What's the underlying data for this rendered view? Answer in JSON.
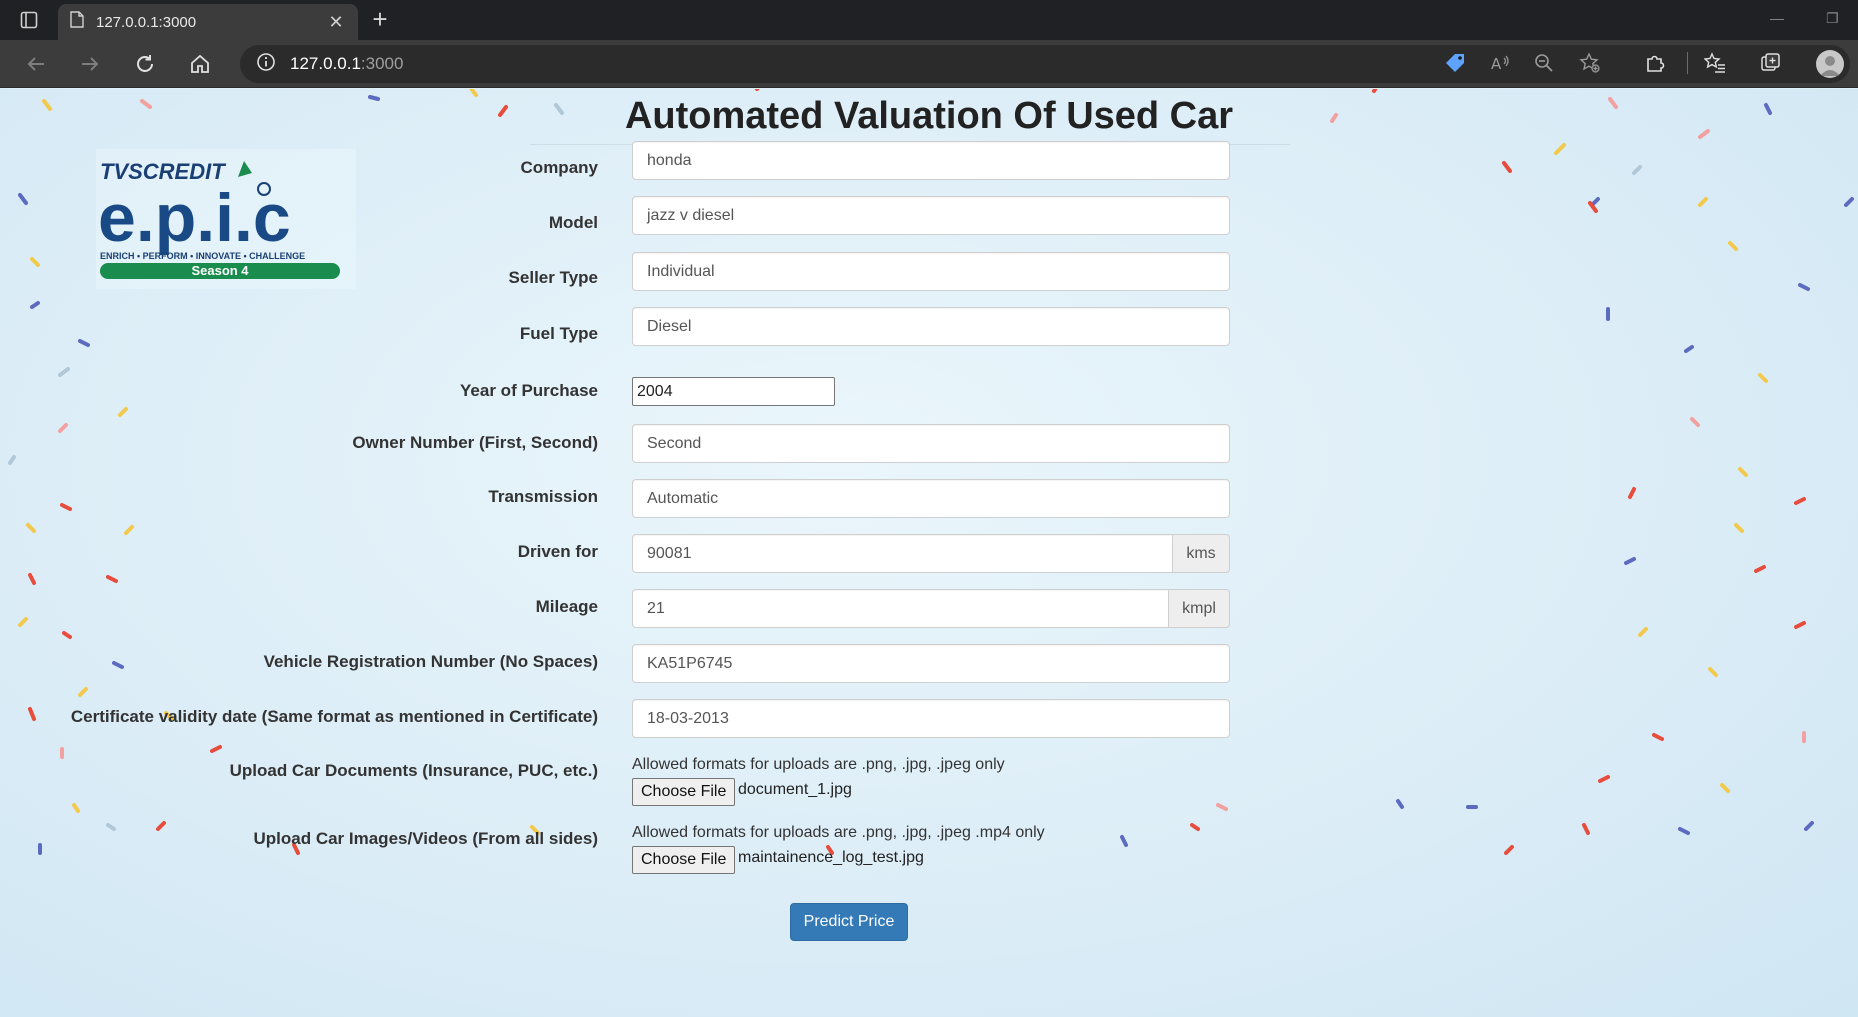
{
  "browser": {
    "tab_title": "127.0.0.1:3000",
    "address_host": "127.0.0.1",
    "address_port": ":3000"
  },
  "page": {
    "title": "Automated Valuation Of Used Car"
  },
  "logo": {
    "brand": "TVSCREDIT",
    "mark": "e.p.i.c",
    "tagline": "ENRICH • PERFORM • INNOVATE • CHALLENGE",
    "season": "Season 4"
  },
  "form": {
    "company": {
      "label": "Company",
      "value": "honda"
    },
    "model": {
      "label": "Model",
      "value": "jazz v diesel"
    },
    "seller_type": {
      "label": "Seller Type",
      "value": "Individual"
    },
    "fuel_type": {
      "label": "Fuel Type",
      "value": "Diesel"
    },
    "year": {
      "label": "Year of Purchase",
      "value": "2004"
    },
    "owner": {
      "label": "Owner Number (First, Second)",
      "value": "Second"
    },
    "transmission": {
      "label": "Transmission",
      "value": "Automatic"
    },
    "driven": {
      "label": "Driven for",
      "value": "90081",
      "unit": "kms"
    },
    "mileage": {
      "label": "Mileage",
      "value": "21",
      "unit": "kmpl"
    },
    "registration": {
      "label": "Vehicle Registration Number (No Spaces)",
      "value": "KA51P6745"
    },
    "certificate": {
      "label": "Certificate validity date (Same format as mentioned in Certificate)",
      "value": "18-03-2013"
    },
    "documents": {
      "label": "Upload Car Documents (Insurance, PUC, etc.)",
      "hint": "Allowed formats for uploads are .png, .jpg, .jpeg only",
      "button": "Choose File",
      "file": "document_1.jpg"
    },
    "images": {
      "label": "Upload Car Images/Videos (From all sides)",
      "hint": "Allowed formats for uploads are .png, .jpg, .jpeg .mp4 only",
      "button": "Choose File",
      "file": "maintainence_log_test.jpg"
    },
    "submit": "Predict Price"
  }
}
